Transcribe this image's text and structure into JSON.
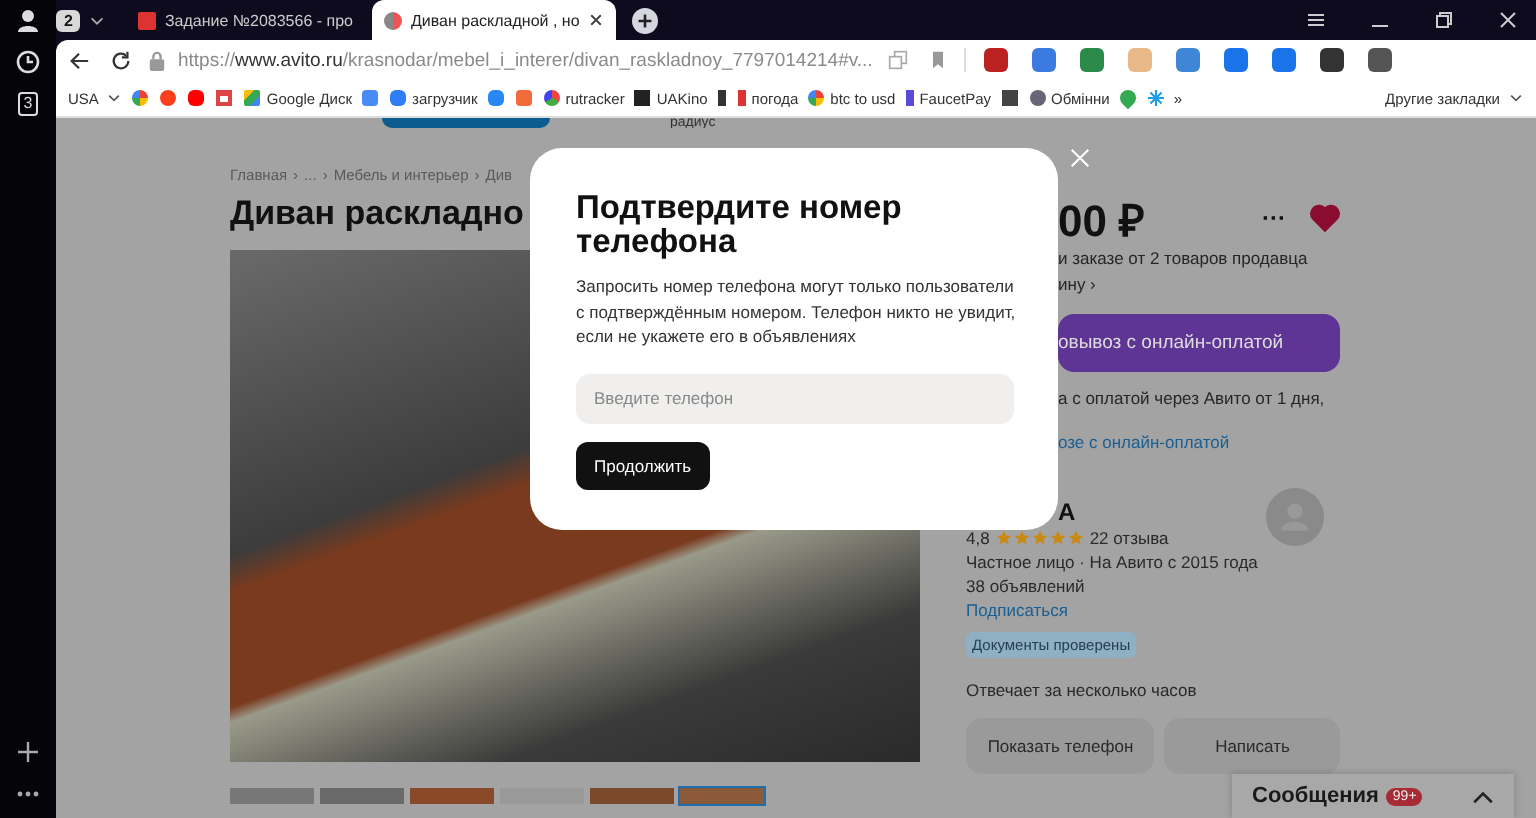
{
  "sidebar": {
    "tab_count": "3"
  },
  "tabs": {
    "counter": "2",
    "items": [
      {
        "label": "Задание №2083566 - про",
        "selected": false
      },
      {
        "label": "Диван раскладной , но",
        "selected": true
      }
    ]
  },
  "address_bar": {
    "scheme": "https://",
    "domain": "www.avito.ru",
    "path": "/krasnodar/mebel_i_interer/divan_raskladnoy_7797014214#v..."
  },
  "bookmarks": {
    "profile": "USA",
    "items": [
      "Google Диск",
      "загрузчик",
      "rutracker",
      "UAKino",
      "погода",
      "btc to usd",
      "FaucetPay",
      "Обмінни"
    ],
    "more": "»",
    "other": "Другие закладки"
  },
  "page": {
    "top_link": "радиус",
    "breadcrumbs": [
      "Главная",
      "›",
      "...",
      "›",
      "Мебель и интерьер",
      "›",
      "Див"
    ],
    "title": "Диван раскладно",
    "price": "00 ₽",
    "more": "···",
    "favorite": true,
    "bulk_note": [
      "и заказе от 2 товаров продавца",
      "ину ›"
    ],
    "delivery_button": "овывоз с онлайн-оплатой",
    "delivery_note": "а с оплатой через Авито от 1 дня,",
    "delivery_link": "озе с онлайн-оплатой",
    "seller": {
      "name": "А",
      "rating": "4,8",
      "stars": 5,
      "reviews": "22 отзыва",
      "type": "Частное лицо · На Авито с 2015 года",
      "ads": "38 объявлений",
      "subscribe": "Подписаться",
      "badge": "Документы проверены",
      "response": "Отвечает за несколько часов"
    },
    "buttons": [
      "Показать телефон",
      "Написать"
    ],
    "messages": {
      "label": "Сообщения",
      "count": "99+"
    }
  },
  "modal": {
    "title": "Подтвердите номер телефона",
    "text": "Запросить номер телефона могут только пользователи с подтверждённым номером. Телефон никто не увидит, если не укажете его в объявлениях",
    "placeholder": "Введите телефон",
    "button": "Продолжить"
  }
}
